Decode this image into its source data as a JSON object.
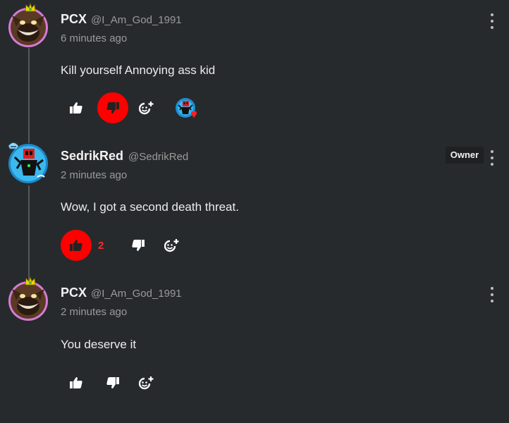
{
  "comments": [
    {
      "author": "PCX",
      "handle": "@I_Am_God_1991",
      "time": "6 minutes ago",
      "text": "Kill yourself Annoying ass kid",
      "disliked": true
    },
    {
      "author": "SedrikRed",
      "handle": "@SedrikRed",
      "badge": "Owner",
      "time": "2 minutes ago",
      "text": "Wow, I got a second death threat.",
      "like_count": "2",
      "liked": true
    },
    {
      "author": "PCX",
      "handle": "@I_Am_God_1991",
      "time": "2 minutes ago",
      "text": "You deserve it"
    }
  ],
  "colors": {
    "background": "#272a2c",
    "active_reaction": "#ff0000",
    "secondary_text": "#9a9a9a"
  },
  "icons": [
    "thumbs-up-icon",
    "thumbs-down-icon",
    "add-reaction-icon",
    "more-vertical-icon"
  ]
}
